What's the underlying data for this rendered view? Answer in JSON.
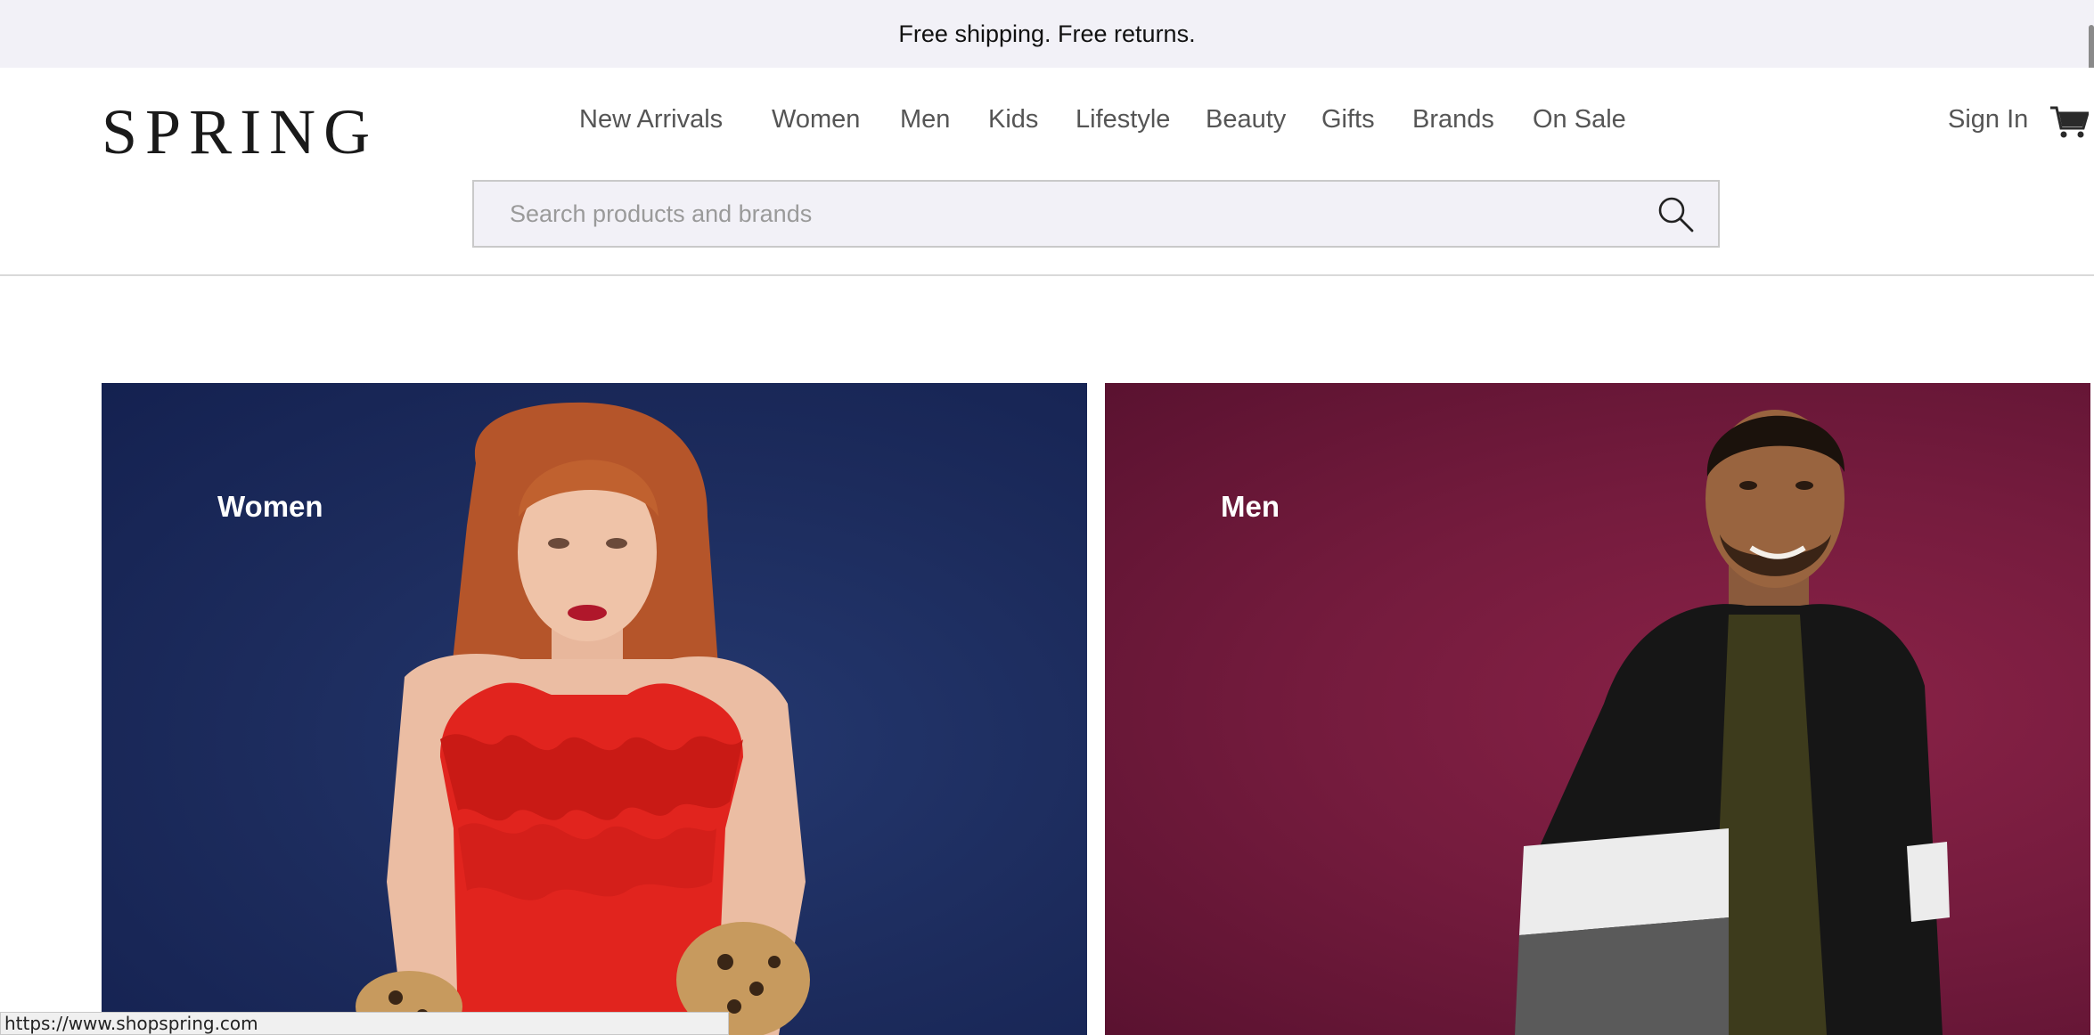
{
  "promo": {
    "text": "Free shipping. Free returns."
  },
  "header": {
    "logo": "SPRING",
    "nav": [
      {
        "label": "New Arrivals"
      },
      {
        "label": "Women"
      },
      {
        "label": "Men"
      },
      {
        "label": "Kids"
      },
      {
        "label": "Lifestyle"
      },
      {
        "label": "Beauty"
      },
      {
        "label": "Gifts"
      },
      {
        "label": "Brands"
      },
      {
        "label": "On Sale"
      }
    ],
    "sign_in": "Sign In",
    "cart_icon": "cart-icon"
  },
  "search": {
    "placeholder": "Search products and brands",
    "value": "",
    "icon": "search-icon"
  },
  "tiles": [
    {
      "label": "Women",
      "background": "#1c2b5c"
    },
    {
      "label": "Men",
      "background": "#741b3d"
    }
  ],
  "status_bar": {
    "url": "https://www.shopspring.com"
  }
}
